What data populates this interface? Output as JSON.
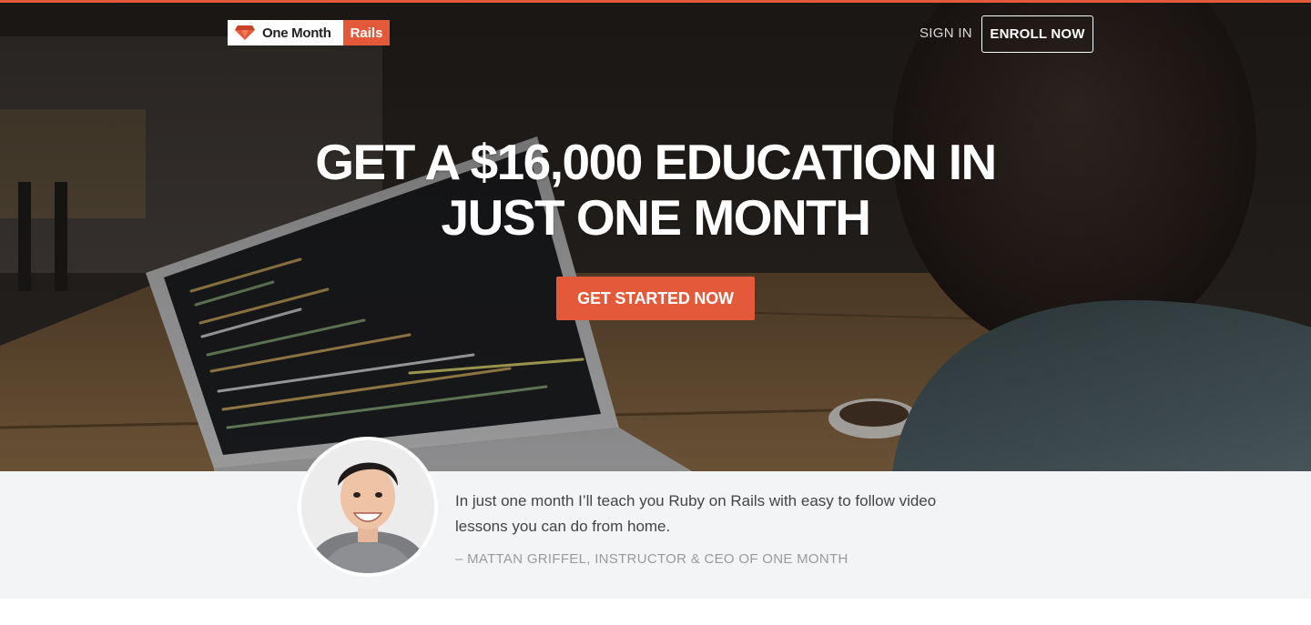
{
  "brand": {
    "name": "One Month",
    "product": "Rails",
    "accent_color": "#e4593a"
  },
  "nav": {
    "signin_label": "SIGN IN",
    "enroll_label": "ENROLL NOW"
  },
  "hero": {
    "headline_line1": "GET A $16,000 EDUCATION IN",
    "headline_line2": "JUST ONE MONTH",
    "cta_label": "GET STARTED NOW"
  },
  "testimonial": {
    "quote_line1": "In just one month I’ll teach you Ruby on Rails with easy to follow video",
    "quote_line2": "lessons you can do from home.",
    "attribution": "– MATTAN GRIFFEL, INSTRUCTOR & CEO OF ONE MONTH"
  },
  "icons": {
    "logo": "ruby-gem-icon",
    "avatar": "instructor-portrait"
  }
}
